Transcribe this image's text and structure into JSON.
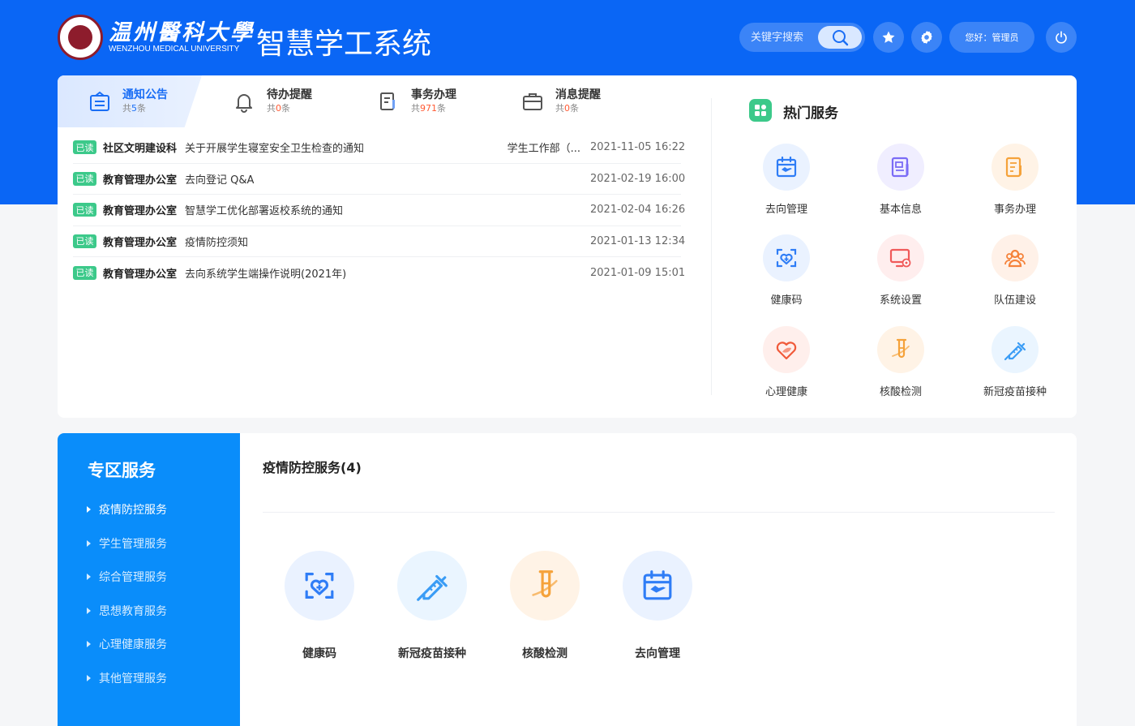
{
  "header": {
    "logo_cn": "温州醫科大學",
    "logo_en": "WENZHOU MEDICAL UNIVERSITY",
    "system_title": "智慧学工系统",
    "search_placeholder": "关键字搜索",
    "greeting": "您好：管理员"
  },
  "tabs": [
    {
      "title": "通知公告",
      "count_prefix": "共",
      "count": "5",
      "count_suffix": "条",
      "icon": "notice-board-icon"
    },
    {
      "title": "待办提醒",
      "count_prefix": "共",
      "count": "0",
      "count_suffix": "条",
      "icon": "bell-icon"
    },
    {
      "title": "事务办理",
      "count_prefix": "共",
      "count": "971",
      "count_suffix": "条",
      "icon": "document-edit-icon"
    },
    {
      "title": "消息提醒",
      "count_prefix": "共",
      "count": "0",
      "count_suffix": "条",
      "icon": "briefcase-icon"
    }
  ],
  "notices": [
    {
      "badge": "已读",
      "dept": "社区文明建设科",
      "title": "关于开展学生寝室安全卫生检查的通知",
      "source": "学生工作部（...",
      "time": "2021-11-05 16:22"
    },
    {
      "badge": "已读",
      "dept": "教育管理办公室",
      "title": "去向登记 Q&A",
      "source": "",
      "time": "2021-02-19 16:00"
    },
    {
      "badge": "已读",
      "dept": "教育管理办公室",
      "title": "智慧学工优化部署返校系统的通知",
      "source": "",
      "time": "2021-02-04 16:26"
    },
    {
      "badge": "已读",
      "dept": "教育管理办公室",
      "title": "疫情防控须知",
      "source": "",
      "time": "2021-01-13 12:34"
    },
    {
      "badge": "已读",
      "dept": "教育管理办公室",
      "title": "去向系统学生端操作说明(2021年)",
      "source": "",
      "time": "2021-01-09 15:01"
    }
  ],
  "hot_services": {
    "title": "热门服务",
    "items": [
      {
        "label": "去向管理",
        "icon": "calendar-plane-icon",
        "color": "#2f7df6",
        "bg": "#eaf2ff"
      },
      {
        "label": "基本信息",
        "icon": "profile-card-icon",
        "color": "#7b6cf6",
        "bg": "#f0eeff"
      },
      {
        "label": "事务办理",
        "icon": "form-edit-icon",
        "color": "#f5a23a",
        "bg": "#fff3e6"
      },
      {
        "label": "健康码",
        "icon": "health-heart-icon",
        "color": "#2f7df6",
        "bg": "#eaf2ff"
      },
      {
        "label": "系统设置",
        "icon": "monitor-gear-icon",
        "color": "#f05a5a",
        "bg": "#ffeeee"
      },
      {
        "label": "队伍建设",
        "icon": "team-icon",
        "color": "#f5823a",
        "bg": "#fff1e8"
      },
      {
        "label": "心理健康",
        "icon": "heart-leaf-icon",
        "color": "#f05a3a",
        "bg": "#ffefec"
      },
      {
        "label": "核酸检测",
        "icon": "test-tube-icon",
        "color": "#f5a23a",
        "bg": "#fff3e6"
      },
      {
        "label": "新冠疫苗接种",
        "icon": "syringe-icon",
        "color": "#3a9cf5",
        "bg": "#eaf5ff"
      }
    ]
  },
  "zone": {
    "title": "专区服务",
    "items": [
      "疫情防控服务",
      "学生管理服务",
      "综合管理服务",
      "思想教育服务",
      "心理健康服务",
      "其他管理服务"
    ],
    "active_index": 0,
    "section_title": "疫情防控服务(4)",
    "services": [
      {
        "label": "健康码",
        "icon": "health-heart-icon",
        "color": "#2f7df6",
        "bg": "#eaf2ff"
      },
      {
        "label": "新冠疫苗接种",
        "icon": "syringe-icon",
        "color": "#3a9cf5",
        "bg": "#eaf5ff"
      },
      {
        "label": "核酸检测",
        "icon": "test-tube-icon",
        "color": "#f5a23a",
        "bg": "#fff3e6"
      },
      {
        "label": "去向管理",
        "icon": "calendar-plane-icon",
        "color": "#2f7df6",
        "bg": "#eaf2ff"
      }
    ]
  },
  "colors": {
    "brand": "#0a66f5",
    "zone_side": "#0a8dfa",
    "read_badge": "#3cc98a",
    "count_highlight": "#ff5a33"
  }
}
